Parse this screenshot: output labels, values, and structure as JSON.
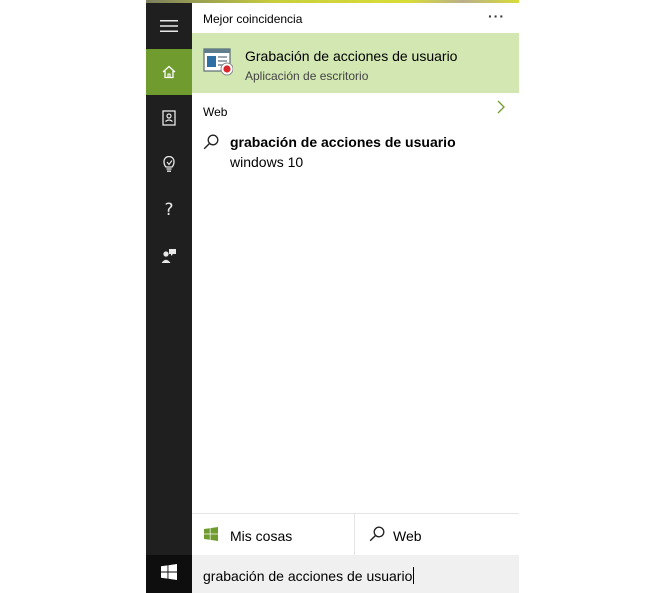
{
  "rail": {
    "items": [
      {
        "name": "menu",
        "icon": "hamburger-icon"
      },
      {
        "name": "home",
        "icon": "home-icon",
        "active": true
      },
      {
        "name": "notebook",
        "icon": "notebook-icon"
      },
      {
        "name": "reminders",
        "icon": "lightbulb-icon"
      },
      {
        "name": "help",
        "icon": "help-icon",
        "glyph": "?"
      },
      {
        "name": "feedback",
        "icon": "feedback-icon"
      }
    ]
  },
  "best_match": {
    "header": "Mejor coincidencia",
    "more": "···",
    "app_title": "Grabación de acciones de usuario",
    "app_subtitle": "Aplicación de escritorio"
  },
  "web": {
    "header": "Web",
    "suggestion_title": "grabación de acciones de usuario",
    "suggestion_subtitle": "windows 10"
  },
  "tabs": {
    "mine_label": "Mis cosas",
    "web_label": "Web"
  },
  "search": {
    "value": "grabación de acciones de usuario"
  },
  "colors": {
    "rail_bg": "#1f1f1f",
    "accent": "#6f9b2f",
    "highlight": "#d2e7b2",
    "search_bg": "#f0f0f0"
  }
}
